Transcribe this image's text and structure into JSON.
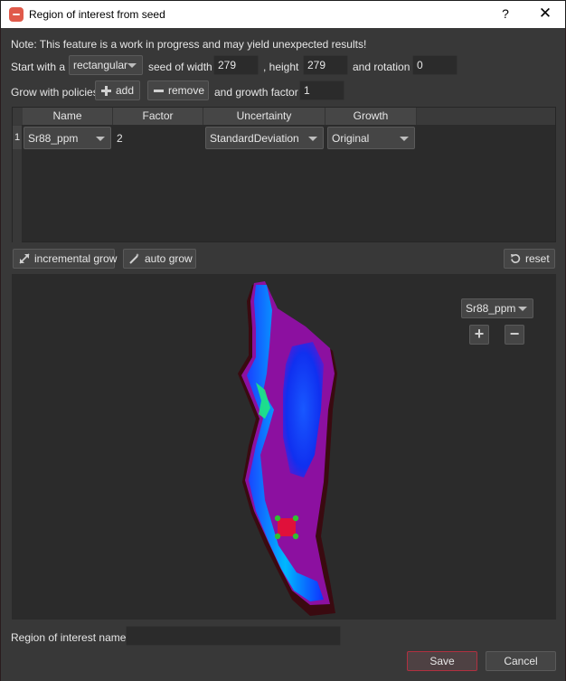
{
  "window": {
    "title": "Region of interest from seed",
    "help_label": "?",
    "close_label": "✕"
  },
  "note": "Note: This feature is a work in progress and may yield unexpected results!",
  "seed": {
    "start_label": "Start with a",
    "shape_value": "rectangular",
    "width_label": "seed of width",
    "width_value": "279",
    "height_label": ", height",
    "height_value": "279",
    "rotation_label": "and rotation",
    "rotation_value": "0"
  },
  "policies": {
    "label": "Grow with policies",
    "add_label": "add",
    "remove_label": "remove",
    "growth_factor_label": "and growth factor",
    "growth_factor_value": "1"
  },
  "table": {
    "columns": [
      "Name",
      "Factor",
      "Uncertainty",
      "Growth"
    ],
    "rows": [
      {
        "index": "1",
        "name": "Sr88_ppm",
        "factor": "2",
        "uncertainty": "StandardDeviation",
        "growth": "Original"
      }
    ]
  },
  "actions": {
    "incremental_grow_label": "incremental grow",
    "auto_grow_label": "auto grow",
    "reset_label": "reset"
  },
  "viewer": {
    "channel_value": "Sr88_ppm",
    "zoom_in_label": "+",
    "zoom_out_label": "−",
    "colormap": [
      "#3a0a10",
      "#8a0a8a",
      "#9a1aa8",
      "#1030ff",
      "#00c8ff",
      "#20ff80"
    ],
    "seed_color": "#e0103a",
    "handle_color": "#30c030"
  },
  "footer": {
    "roi_name_label": "Region of interest name:",
    "roi_name_value": "",
    "save_label": "Save",
    "cancel_label": "Cancel"
  }
}
